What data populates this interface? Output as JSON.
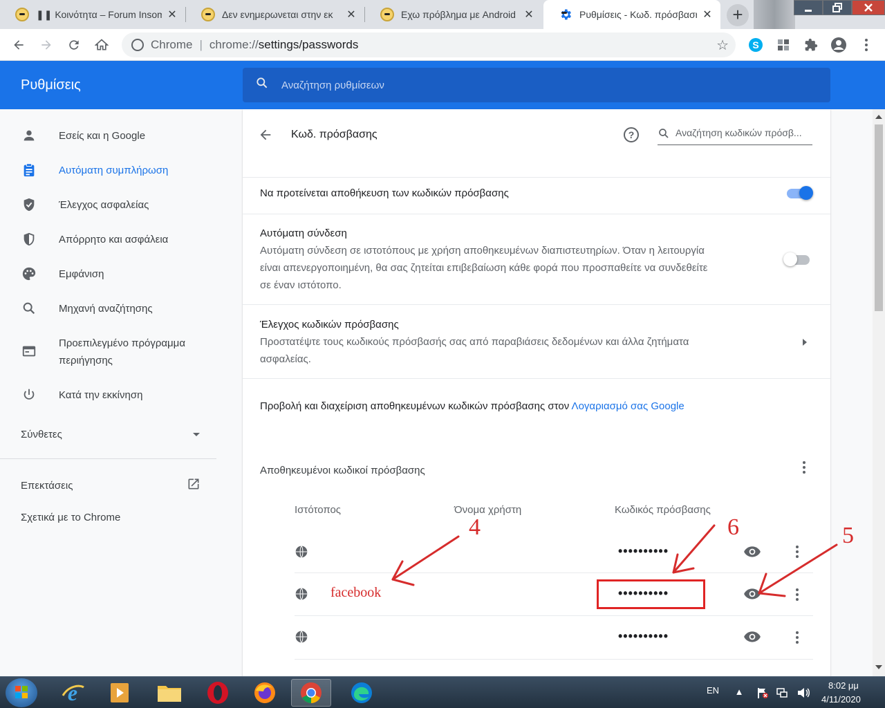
{
  "browser": {
    "tabs": [
      {
        "title": "❚❚ Κοινότητα – Forum Insomnia",
        "active": false
      },
      {
        "title": "Δεν ενημερωνεται στην εκ",
        "active": false
      },
      {
        "title": "Εχω πρόβλημα με Android",
        "active": false
      },
      {
        "title": "Ρυθμίσεις - Κωδ. πρόσβασης",
        "active": true
      }
    ],
    "close_glyph": "✕",
    "new_tab_glyph": "+",
    "omnibox": {
      "site_label": "Chrome",
      "separator": "|",
      "url_scheme": "chrome://",
      "url_path": "settings/passwords"
    }
  },
  "settings": {
    "header_title": "Ρυθμίσεις",
    "search_placeholder": "Αναζήτηση ρυθμίσεων",
    "nav": [
      {
        "label": "Εσείς και η Google",
        "icon": "person-icon"
      },
      {
        "label": "Αυτόματη συμπλήρωση",
        "icon": "clipboard-icon",
        "active": true
      },
      {
        "label": "Έλεγχος ασφαλείας",
        "icon": "shield-check-icon"
      },
      {
        "label": "Απόρρητο και ασφάλεια",
        "icon": "shield-icon"
      },
      {
        "label": "Εμφάνιση",
        "icon": "palette-icon"
      },
      {
        "label": "Μηχανή αναζήτησης",
        "icon": "search-icon"
      },
      {
        "label": "Προεπιλεγμένο πρόγραμμα περιήγησης",
        "icon": "browser-icon"
      },
      {
        "label": "Κατά την εκκίνηση",
        "icon": "power-icon"
      }
    ],
    "advanced_label": "Σύνθετες",
    "extensions_label": "Επεκτάσεις",
    "about_label": "Σχετικά με το Chrome"
  },
  "passwords": {
    "page_title": "Κωδ. πρόσβασης",
    "search_placeholder": "Αναζήτηση κωδικών πρόσβ...",
    "offer_to_save": {
      "label": "Να προτείνεται αποθήκευση των κωδικών πρόσβασης",
      "enabled": true
    },
    "auto_signin": {
      "label": "Αυτόματη σύνδεση",
      "desc_line1": "Αυτόματη σύνδεση σε ιστοτόπους με χρήση αποθηκευμένων διαπιστευτηρίων. Όταν η λειτουργία",
      "desc_line2": "είναι απενεργοποιημένη, θα σας ζητείται επιβεβαίωση κάθε φορά που προσπαθείτε να συνδεθείτε",
      "desc_line3": "σε έναν ιστότοπο.",
      "enabled": false
    },
    "check": {
      "label": "Έλεγχος κωδικών πρόσβασης",
      "desc_line1": "Προστατέψτε τους κωδικούς πρόσβασής σας από παραβιάσεις δεδομένων και άλλα ζητήματα",
      "desc_line2": "ασφαλείας."
    },
    "manage_text": "Προβολή και διαχείριση αποθηκευμένων κωδικών πρόσβασης στον ",
    "manage_link": "Λογαριασμό σας Google",
    "saved_header": "Αποθηκευμένοι κωδικοί πρόσβασης",
    "columns": {
      "site": "Ιστότοπος",
      "username": "Όνομα χρήστη",
      "password": "Κωδικός πρόσβασης"
    },
    "rows": [
      {
        "site": "",
        "username": "",
        "password": "••••••••••"
      },
      {
        "site": "",
        "username": "",
        "password": "••••••••••"
      },
      {
        "site": "",
        "username": "",
        "password": "••••••••••"
      }
    ]
  },
  "annotations": {
    "num4": "4",
    "num5": "5",
    "num6": "6",
    "site_label": "facebook",
    "color": "#d62c2c"
  },
  "taskbar": {
    "lang": "EN",
    "time": "8:02 μμ",
    "date": "4/11/2020"
  },
  "colors": {
    "accent": "#1a73e8",
    "header_bg": "#1a73e8",
    "search_bg": "#1a5ec4"
  }
}
